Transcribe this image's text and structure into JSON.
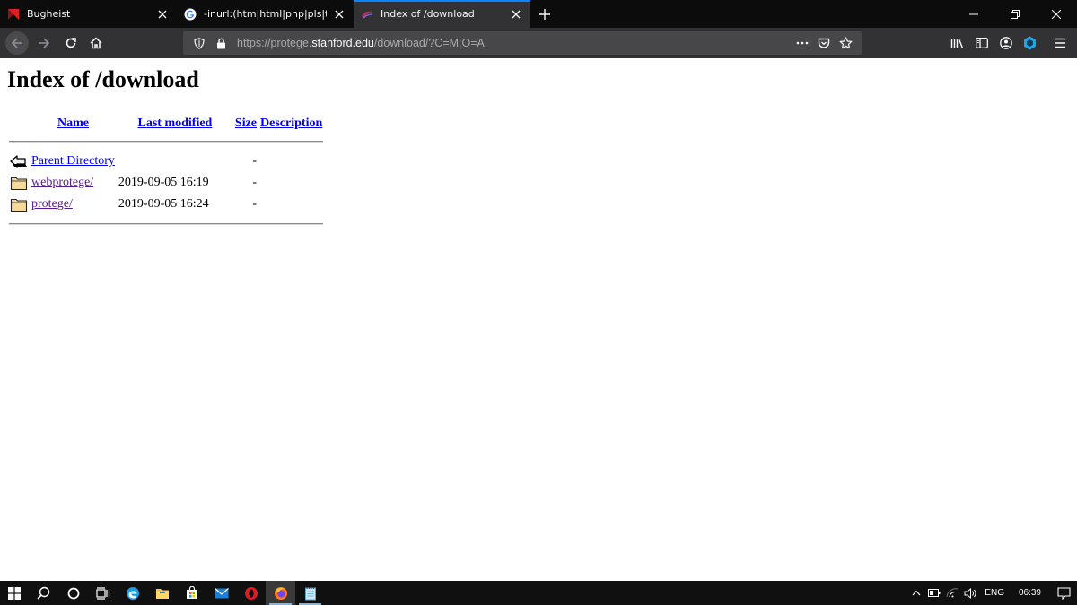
{
  "browser": {
    "tabs": [
      {
        "title": "Bugheist",
        "favicon": "bugheist-logo",
        "active": false
      },
      {
        "title": "-inurl:(htm|html|php|pls|txt) in",
        "favicon": "google-g",
        "active": false
      },
      {
        "title": "Index of /download",
        "favicon": "protege-logo",
        "active": true
      }
    ],
    "new_tab_icon": "plus-icon",
    "url_prefix": "https://protege.",
    "url_host": "stanford.edu",
    "url_path": "/download/?C=M;O=A",
    "accent_color": "#0a84ff"
  },
  "page": {
    "heading": "Index of /download",
    "columns": {
      "name": "Name",
      "modified": "Last modified",
      "size": "Size",
      "description": "Description"
    },
    "rows": [
      {
        "icon": "back-arrow-icon",
        "name": "Parent Directory",
        "modified": "",
        "size": "-",
        "description": ""
      },
      {
        "icon": "folder-icon",
        "name": "webprotege/",
        "modified": "2019-09-05 16:19",
        "size": "-",
        "description": ""
      },
      {
        "icon": "folder-icon",
        "name": "protege/",
        "modified": "2019-09-05 16:24",
        "size": "-",
        "description": ""
      }
    ]
  },
  "taskbar": {
    "language": "ENG",
    "time": "06:39"
  }
}
